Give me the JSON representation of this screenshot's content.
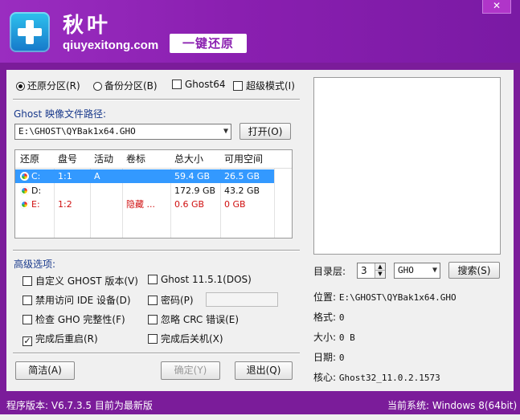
{
  "header": {
    "app_title": "秋叶",
    "domain": "qiuyexitong.com",
    "slogan": "一键还原",
    "close_label": "✕"
  },
  "mode": {
    "options": [
      {
        "label": "还原分区(R)",
        "selected": true
      },
      {
        "label": "备份分区(B)",
        "selected": false
      }
    ],
    "ghost64": {
      "label": "Ghost64",
      "checked": false
    },
    "super_mode": {
      "label": "超级模式(I)",
      "checked": false
    }
  },
  "image_path": {
    "label": "Ghost 映像文件路径:",
    "value": "E:\\GHOST\\QYBak1x64.GHO",
    "open_button": "打开(O)"
  },
  "partition_table": {
    "columns": [
      "还原",
      "盘号",
      "活动",
      "卷标",
      "总大小",
      "可用空间"
    ],
    "rows": [
      {
        "drive": "C:",
        "disk_no": "1:1",
        "active": "A",
        "label": "",
        "total": "59.4 GB",
        "free": "26.5 GB",
        "selected": true,
        "style": "selected"
      },
      {
        "drive": "D:",
        "disk_no": "",
        "active": "",
        "label": "",
        "total": "172.9 GB",
        "free": "43.2 GB",
        "selected": false,
        "style": "normal"
      },
      {
        "drive": "E:",
        "disk_no": "1:2",
        "active": "",
        "label": "隐藏 ...",
        "total": "0.6 GB",
        "free": "0 GB",
        "selected": false,
        "style": "hidden"
      }
    ]
  },
  "advanced": {
    "title": "高级选项:",
    "options": [
      {
        "label": "自定义 GHOST 版本(V)",
        "checked": false
      },
      {
        "label": "Ghost 11.5.1(DOS)",
        "checked": false
      },
      {
        "label": "禁用访问 IDE 设备(D)",
        "checked": false
      },
      {
        "label": "密码(P)",
        "checked": false
      },
      {
        "label": "检查 GHO 完整性(F)",
        "checked": false
      },
      {
        "label": "忽略 CRC 错误(E)",
        "checked": false
      },
      {
        "label": "完成后重启(R)",
        "checked": true
      },
      {
        "label": "完成后关机(X)",
        "checked": false
      }
    ]
  },
  "buttons": {
    "simple": "简洁(A)",
    "ok": "确定(Y)",
    "exit": "退出(Q)"
  },
  "right_panel": {
    "dir_level_label": "目录层:",
    "dir_level_value": "3",
    "ext_value": "GHO",
    "search_button": "搜索(S)",
    "location_label": "位置:",
    "location_value": "E:\\GHOST\\QYBak1x64.GHO",
    "format_label": "格式:",
    "format_value": "0",
    "size_label": "大小:",
    "size_value": "0 B",
    "date_label": "日期:",
    "date_value": "0",
    "core_label": "核心:",
    "core_value": "Ghost32_11.0.2.1573"
  },
  "status": {
    "version": "程序版本: V6.7.3.5  目前为最新版",
    "system": "当前系统: Windows 8(64bit)"
  },
  "colors": {
    "brand_purple": "#8a1fb0",
    "selection_blue": "#3399ff",
    "hidden_red": "#d01010"
  }
}
